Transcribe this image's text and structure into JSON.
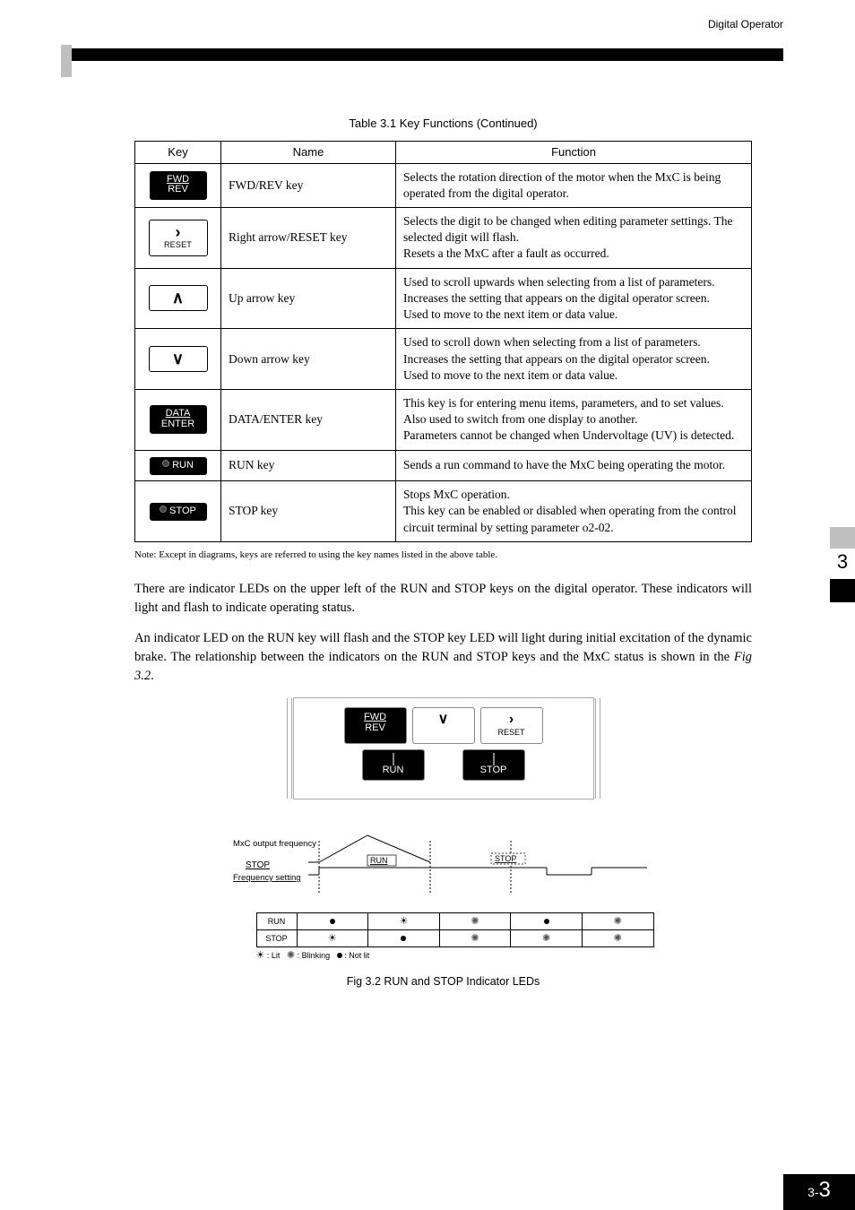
{
  "header": {
    "running_head": "Digital Operator"
  },
  "tableCaption": "Table 3.1  Key Functions (Continued)",
  "columns": {
    "key": "Key",
    "name": "Name",
    "function": "Function"
  },
  "rows": [
    {
      "icon": {
        "kind": "black",
        "lines": [
          "FWD",
          "REV"
        ],
        "underlineTop": true
      },
      "name": "FWD/REV key",
      "fn": "Selects the rotation direction of the motor when the MxC is being operated from the digital operator."
    },
    {
      "icon": {
        "kind": "white",
        "glyph": "›",
        "sub": "RESET"
      },
      "name": "Right arrow/RESET key",
      "fn": "Selects the digit to be changed when editing parameter settings. The selected digit will flash.\nResets a the MxC after a fault as occurred."
    },
    {
      "icon": {
        "kind": "white",
        "glyph": "∧"
      },
      "name": "Up arrow key",
      "fn": "Used to scroll upwards when selecting from a list of parameters.\nIncreases the setting that appears on the digital operator screen.\nUsed to move to the next item or data value."
    },
    {
      "icon": {
        "kind": "white",
        "glyph": "∨"
      },
      "name": "Down arrow key",
      "fn": "Used to scroll down when selecting from a list of parameters.\nIncreases the setting that appears on the digital operator screen.\nUsed to move to the next item or data value."
    },
    {
      "icon": {
        "kind": "black",
        "lines": [
          "DATA",
          "ENTER"
        ],
        "underlineTop": true
      },
      "name": "DATA/ENTER key",
      "fn": "This key is for entering menu items, parameters, and to set values. Also used to switch from one display to another.\nParameters cannot be changed when Undervoltage (UV) is detected."
    },
    {
      "icon": {
        "kind": "black",
        "dot": true,
        "lines": [
          "RUN"
        ]
      },
      "name": "RUN key",
      "fn": "Sends a run command to have the MxC being operating the motor."
    },
    {
      "icon": {
        "kind": "black",
        "dot": true,
        "lines": [
          "STOP"
        ]
      },
      "name": "STOP key",
      "fn": "Stops MxC operation.\nThis key can be enabled or disabled when operating from the control circuit terminal by setting parameter o2-02."
    }
  ],
  "note": "Note: Except in diagrams, keys are referred to using the key names listed in the above table.",
  "paragraphs": [
    "There are indicator LEDs on the upper left of the RUN and STOP keys on the digital operator. These indicators will light and flash to indicate operating status.",
    "An indicator LED on the RUN key will flash and the STOP key LED will light during initial excitation of the dynamic brake. The relationship between the indicators on the RUN and STOP keys and the MxC status is shown in the "
  ],
  "figRef": "Fig 3.2",
  "keypad": {
    "top": [
      {
        "type": "black",
        "top": "FWD",
        "bottom": "REV",
        "underlineTop": true
      },
      {
        "type": "white",
        "glyph": "∨"
      },
      {
        "type": "white",
        "glyph": "›",
        "sub": "RESET"
      }
    ],
    "bottom": [
      {
        "type": "black",
        "dot": true,
        "label": "RUN"
      },
      {
        "type": "black",
        "dot": true,
        "label": "STOP"
      }
    ]
  },
  "timing": {
    "outputLabel": "MxC output frequency",
    "freqLabel": "Frequency setting",
    "startTag": "STOP",
    "runTag": "RUN",
    "stopTag": "STOP",
    "ledRows": {
      "run": "RUN",
      "stop": "STOP"
    },
    "ledStates": {
      "run": [
        "dot",
        "sun",
        "dim",
        "dot",
        "dim"
      ],
      "stop": [
        "sun",
        "dot",
        "dim",
        "dim",
        "dimsun"
      ]
    },
    "legend": ": Lit      : Blinking   ● : Not lit"
  },
  "figCaption": "Fig 3.2  RUN and STOP Indicator LEDs",
  "sideTab": {
    "digit": "3"
  },
  "footer": {
    "prefix": "3-",
    "page": "3"
  }
}
